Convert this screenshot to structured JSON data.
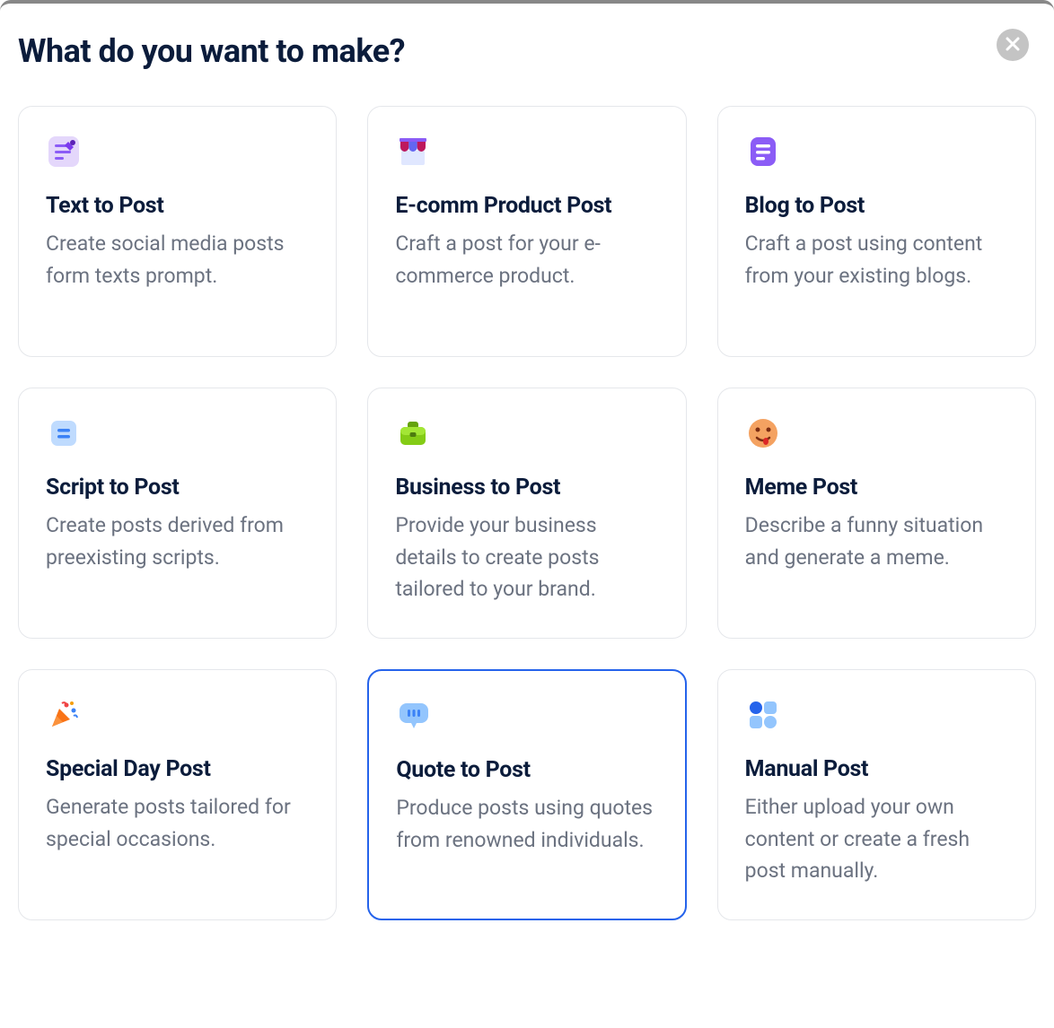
{
  "modal": {
    "title": "What do you want to make?"
  },
  "cards": [
    {
      "id": "text-to-post",
      "title": "Text to Post",
      "desc": "Create social media posts form texts prompt.",
      "selected": false
    },
    {
      "id": "ecomm-product-post",
      "title": "E-comm Product Post",
      "desc": "Craft a post for your e-commerce product.",
      "selected": false
    },
    {
      "id": "blog-to-post",
      "title": "Blog to Post",
      "desc": "Craft a post using content from your existing blogs.",
      "selected": false
    },
    {
      "id": "script-to-post",
      "title": "Script to Post",
      "desc": "Create posts derived from preexisting scripts.",
      "selected": false
    },
    {
      "id": "business-to-post",
      "title": "Business to Post",
      "desc": "Provide your business details to create posts tailored to your brand.",
      "selected": false
    },
    {
      "id": "meme-post",
      "title": "Meme Post",
      "desc": "Describe a funny situation and generate a meme.",
      "selected": false
    },
    {
      "id": "special-day-post",
      "title": "Special Day Post",
      "desc": "Generate posts tailored for special occasions.",
      "selected": false
    },
    {
      "id": "quote-to-post",
      "title": "Quote to Post",
      "desc": "Produce posts using quotes from renowned individuals.",
      "selected": true
    },
    {
      "id": "manual-post",
      "title": "Manual Post",
      "desc": "Either upload your own content or create a fresh post manually.",
      "selected": false
    }
  ]
}
